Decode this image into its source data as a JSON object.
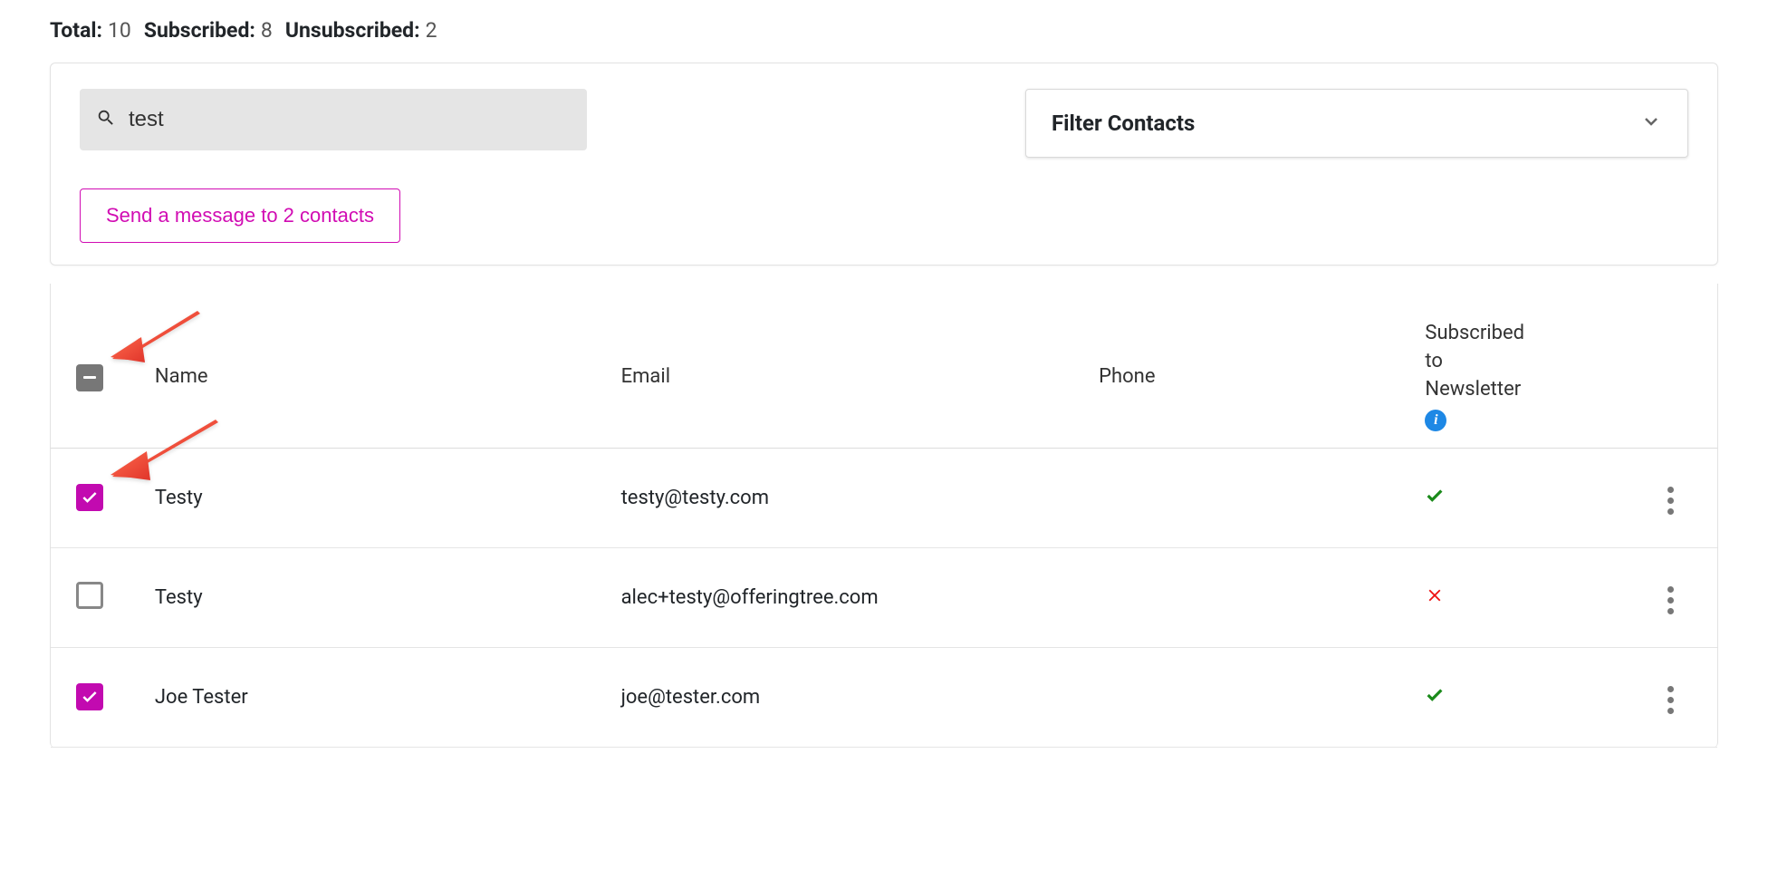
{
  "stats": {
    "total_label": "Total:",
    "total_value": "10",
    "subscribed_label": "Subscribed:",
    "subscribed_value": "8",
    "unsubscribed_label": "Unsubscribed:",
    "unsubscribed_value": "2"
  },
  "search": {
    "value": "test"
  },
  "filter": {
    "label": "Filter Contacts"
  },
  "actions": {
    "send_message_label": "Send a message to 2 contacts"
  },
  "table": {
    "headers": {
      "name": "Name",
      "email": "Email",
      "phone": "Phone",
      "subscribed_line1": "Subscribed",
      "subscribed_line2": "to",
      "subscribed_line3": "Newsletter"
    },
    "rows": [
      {
        "checked": true,
        "name": "Testy",
        "email": "testy@testy.com",
        "phone": "",
        "subscribed": true
      },
      {
        "checked": false,
        "name": "Testy",
        "email": "alec+testy@offeringtree.com",
        "phone": "",
        "subscribed": false
      },
      {
        "checked": true,
        "name": "Joe Tester",
        "email": "joe@tester.com",
        "phone": "",
        "subscribed": true
      }
    ]
  },
  "info_icon_text": "i"
}
